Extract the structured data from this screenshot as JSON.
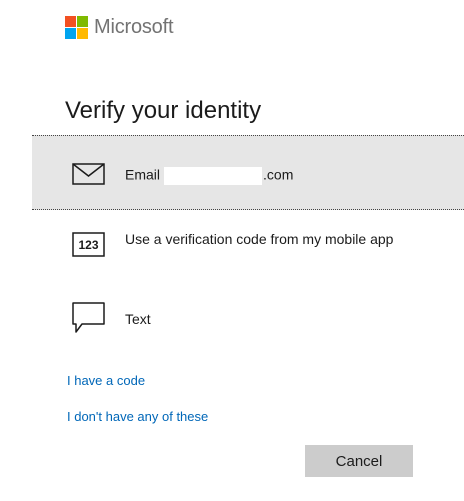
{
  "brand": {
    "name": "Microsoft",
    "colors": {
      "red": "#f25022",
      "green": "#7fba00",
      "blue": "#00a4ef",
      "yellow": "#ffb900"
    }
  },
  "title": "Verify your identity",
  "options": [
    {
      "icon": "envelope-icon",
      "label_prefix": "Email",
      "label_suffix": ".com",
      "selected": true
    },
    {
      "icon": "code-123-icon",
      "label": "Use a verification code from my mobile app",
      "selected": false
    },
    {
      "icon": "chat-bubble-icon",
      "label": "Text",
      "selected": false
    }
  ],
  "links": {
    "have_code": "I have a code",
    "dont_have": "I don't have any of these"
  },
  "buttons": {
    "cancel": "Cancel"
  },
  "colors": {
    "link": "#0067b8",
    "selected_bg": "#e6e6e6",
    "button_bg": "#cccccc"
  }
}
